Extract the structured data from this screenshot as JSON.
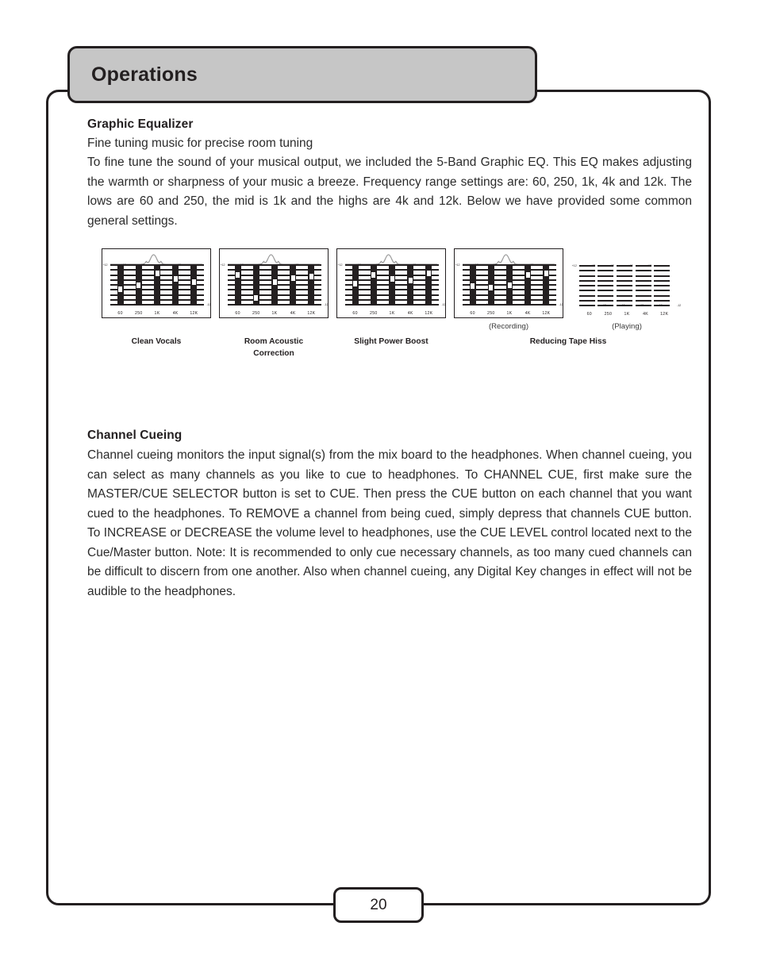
{
  "header": {
    "title": "Operations"
  },
  "page": {
    "number": "20"
  },
  "sections": [
    {
      "heading": "Graphic Equalizer",
      "lead": "Fine tuning music for precise room tuning",
      "body": "To fine tune the sound of your musical output, we included the 5-Band Graphic EQ. This EQ makes adjusting the warmth or sharpness of your music a breeze. Frequency range settings are: 60, 250, 1k, 4k and 12k. The lows are 60 and 250, the mid is 1k and the highs are 4k and 12k. Below we have provided some common general settings."
    },
    {
      "heading": "Channel Cueing",
      "body": "Channel cueing monitors the input signal(s) from the mix board to the headphones. When channel cueing, you can select as many channels as you like to cue to headphones. To CHANNEL CUE, first make sure the MASTER/CUE SELECTOR button is set to CUE. Then press the CUE button on each channel that you want cued to the headphones. To REMOVE a channel from being cued, simply depress that channels CUE button. To INCREASE or DECREASE the volume level to headphones, use the CUE LEVEL control located next to the Cue/Master button. Note: It is recommended to only cue necessary channels, as too many cued channels can be difficult to discern from one another. Also when channel cueing, any Digital Key changes in effect will not be audible to the headphones."
    }
  ],
  "eq_figure": {
    "band_labels": [
      "60",
      "250",
      "1K",
      "4K",
      "12K"
    ],
    "scale_top_label": "+12",
    "scale_bottom_label": "-12",
    "panels": [
      {
        "caption": "Clean Vocals",
        "sub_caption": "",
        "boxed": true,
        "show_curve": true,
        "show_track": true,
        "values": [
          -3,
          0,
          8,
          4,
          2
        ]
      },
      {
        "caption": "Room Acoustic\nCorrection",
        "sub_caption": "",
        "boxed": true,
        "show_curve": true,
        "show_track": true,
        "values": [
          7,
          -9,
          2,
          5,
          6
        ]
      },
      {
        "caption": "Slight Power Boost",
        "sub_caption": "",
        "boxed": true,
        "show_curve": true,
        "show_track": true,
        "values": [
          1,
          7,
          4,
          3,
          8
        ]
      },
      {
        "caption": "",
        "sub_caption": "(Recording)",
        "boxed": true,
        "show_curve": true,
        "show_track": true,
        "values": [
          -1,
          -2,
          0,
          7,
          8
        ]
      },
      {
        "caption": "",
        "sub_caption": "(Playing)",
        "boxed": false,
        "show_curve": false,
        "show_track": false,
        "values": [
          0,
          0,
          0,
          0,
          0
        ]
      }
    ],
    "group_caption": "Reducing Tape Hiss"
  }
}
